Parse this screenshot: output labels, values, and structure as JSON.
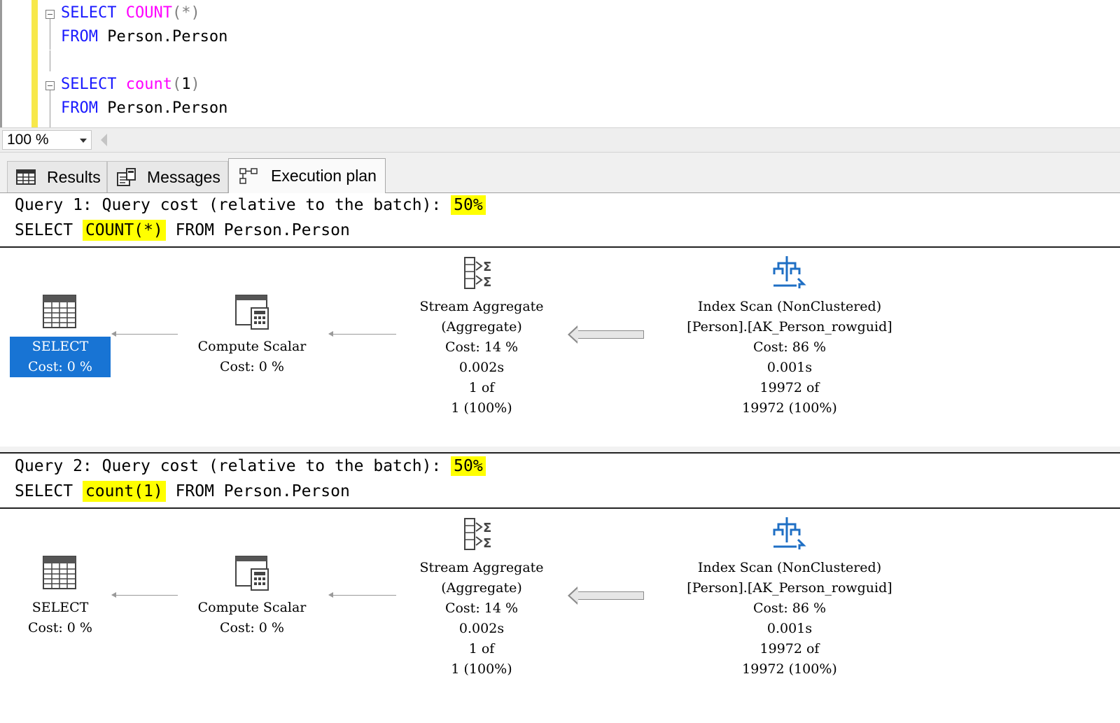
{
  "editor": {
    "queries": [
      {
        "select_kw": "SELECT",
        "func": "COUNT",
        "open": "(",
        "arg": "*",
        "close": ")",
        "from_kw": "FROM",
        "table": "Person.Person"
      },
      {
        "select_kw": "SELECT",
        "func": "count",
        "open": "(",
        "arg": "1",
        "close": ")",
        "from_kw": "FROM",
        "table": "Person.Person"
      }
    ],
    "colors": {
      "keyword": "#1a1aff",
      "function": "#ff00ff",
      "operator": "#808080",
      "gutter": "#f7e84a"
    }
  },
  "zoom": {
    "value": "100 %"
  },
  "tabs": [
    {
      "label": "Results",
      "icon": "grid-icon",
      "active": false
    },
    {
      "label": "Messages",
      "icon": "messages-icon",
      "active": false
    },
    {
      "label": "Execution plan",
      "icon": "execution-plan-icon",
      "active": true
    }
  ],
  "plans": [
    {
      "header_prefix": "Query 1: Query cost (relative to the batch): ",
      "cost_pct": "50%",
      "sql_prefix": "SELECT ",
      "sql_highlight": "COUNT(*)",
      "sql_suffix": " FROM Person.Person",
      "nodes": {
        "select": {
          "line1": "SELECT",
          "line2": "Cost: 0 %",
          "selected": true
        },
        "compute": {
          "line1": "Compute Scalar",
          "line2": "Cost: 0 %"
        },
        "aggregate": {
          "line1": "Stream Aggregate",
          "line2": "(Aggregate)",
          "line3": "Cost: 14 %",
          "line4": "0.002s",
          "line5": "1 of",
          "line6": "1 (100%)"
        },
        "scan": {
          "line1": "Index Scan (NonClustered)",
          "line2": "[Person].[AK_Person_rowguid]",
          "line3": "Cost: 86 %",
          "line4": "0.001s",
          "line5": "19972 of",
          "line6": "19972 (100%)"
        }
      }
    },
    {
      "header_prefix": "Query 2: Query cost (relative to the batch): ",
      "cost_pct": "50%",
      "sql_prefix": "SELECT ",
      "sql_highlight": "count(1)",
      "sql_suffix": " FROM Person.Person",
      "nodes": {
        "select": {
          "line1": "SELECT",
          "line2": "Cost: 0 %",
          "selected": false
        },
        "compute": {
          "line1": "Compute Scalar",
          "line2": "Cost: 0 %"
        },
        "aggregate": {
          "line1": "Stream Aggregate",
          "line2": "(Aggregate)",
          "line3": "Cost: 14 %",
          "line4": "0.002s",
          "line5": "1 of",
          "line6": "1 (100%)"
        },
        "scan": {
          "line1": "Index Scan (NonClustered)",
          "line2": "[Person].[AK_Person_rowguid]",
          "line3": "Cost: 86 %",
          "line4": "0.001s",
          "line5": "19972 of",
          "line6": "19972 (100%)"
        }
      }
    }
  ],
  "theme": {
    "highlight": "#ffff00",
    "selected_node": "#1874d4"
  }
}
